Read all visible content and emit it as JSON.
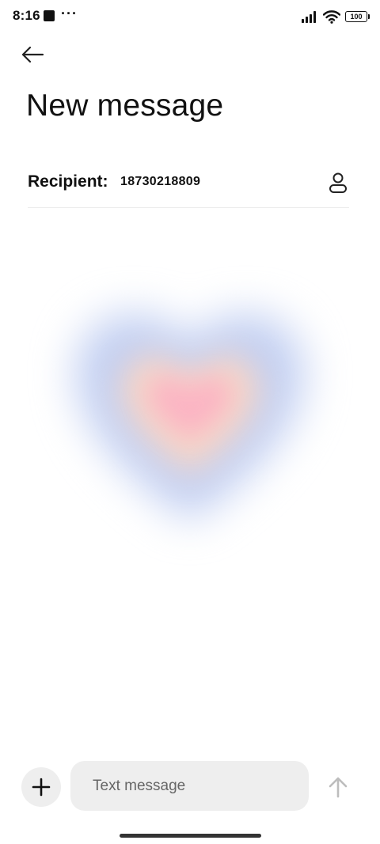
{
  "status_bar": {
    "time": "8:16",
    "more_indicator": "···",
    "battery_level": "100",
    "icons": [
      "app-notification-icon",
      "signal-icon",
      "wifi-icon",
      "battery-icon"
    ]
  },
  "header": {
    "back_icon": "back-arrow-icon",
    "title": "New message"
  },
  "recipient": {
    "label": "Recipient:",
    "value": "18730218809",
    "contact_icon": "person-icon"
  },
  "composer": {
    "attach_icon": "plus-icon",
    "input_value": "",
    "input_placeholder": "Text message",
    "send_icon": "arrow-up-icon"
  },
  "decoration": {
    "heart_colors": {
      "outer": "#c3d0f2",
      "middle": "#f6d6c8",
      "inner": "#fbb4c3"
    }
  },
  "colors": {
    "background": "#ffffff",
    "text": "#111111",
    "input_background": "#eeeeee",
    "send_disabled": "#bdbdbd"
  }
}
